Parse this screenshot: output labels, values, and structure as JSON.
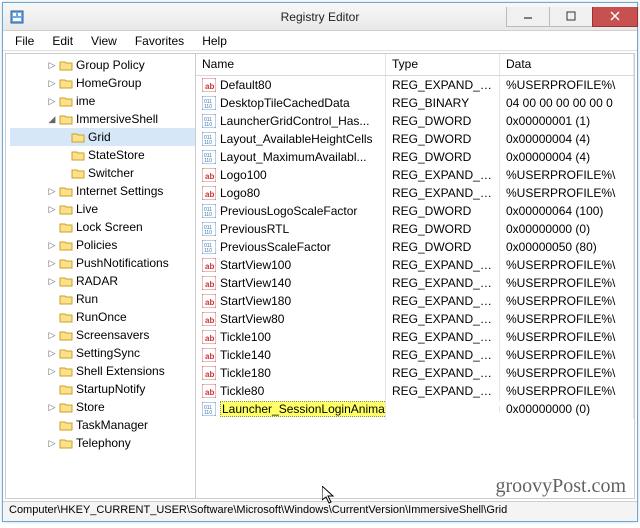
{
  "window": {
    "title": "Registry Editor"
  },
  "menu": {
    "items": [
      "File",
      "Edit",
      "View",
      "Favorites",
      "Help"
    ]
  },
  "tree": {
    "items": [
      {
        "label": "Group Policy",
        "depth": 3,
        "exp": "▷"
      },
      {
        "label": "HomeGroup",
        "depth": 3,
        "exp": "▷"
      },
      {
        "label": "ime",
        "depth": 3,
        "exp": "▷"
      },
      {
        "label": "ImmersiveShell",
        "depth": 3,
        "exp": "◢"
      },
      {
        "label": "Grid",
        "depth": 4,
        "exp": " ",
        "selected": true
      },
      {
        "label": "StateStore",
        "depth": 4,
        "exp": " "
      },
      {
        "label": "Switcher",
        "depth": 4,
        "exp": " "
      },
      {
        "label": "Internet Settings",
        "depth": 3,
        "exp": "▷"
      },
      {
        "label": "Live",
        "depth": 3,
        "exp": "▷"
      },
      {
        "label": "Lock Screen",
        "depth": 3,
        "exp": " "
      },
      {
        "label": "Policies",
        "depth": 3,
        "exp": "▷"
      },
      {
        "label": "PushNotifications",
        "depth": 3,
        "exp": "▷"
      },
      {
        "label": "RADAR",
        "depth": 3,
        "exp": "▷"
      },
      {
        "label": "Run",
        "depth": 3,
        "exp": " "
      },
      {
        "label": "RunOnce",
        "depth": 3,
        "exp": " "
      },
      {
        "label": "Screensavers",
        "depth": 3,
        "exp": "▷"
      },
      {
        "label": "SettingSync",
        "depth": 3,
        "exp": "▷"
      },
      {
        "label": "Shell Extensions",
        "depth": 3,
        "exp": "▷"
      },
      {
        "label": "StartupNotify",
        "depth": 3,
        "exp": " "
      },
      {
        "label": "Store",
        "depth": 3,
        "exp": "▷"
      },
      {
        "label": "TaskManager",
        "depth": 3,
        "exp": " "
      },
      {
        "label": "Telephony",
        "depth": 3,
        "exp": "▷"
      }
    ]
  },
  "list": {
    "headers": {
      "name": "Name",
      "type": "Type",
      "data": "Data"
    },
    "rows": [
      {
        "icon": "str",
        "name": "Default80",
        "type": "REG_EXPAND_SZ",
        "data": "%USERPROFILE%\\"
      },
      {
        "icon": "bin",
        "name": "DesktopTileCachedData",
        "type": "REG_BINARY",
        "data": "04 00 00 00 00 00 0"
      },
      {
        "icon": "bin",
        "name": "LauncherGridControl_Has...",
        "type": "REG_DWORD",
        "data": "0x00000001 (1)"
      },
      {
        "icon": "bin",
        "name": "Layout_AvailableHeightCells",
        "type": "REG_DWORD",
        "data": "0x00000004 (4)"
      },
      {
        "icon": "bin",
        "name": "Layout_MaximumAvailabl...",
        "type": "REG_DWORD",
        "data": "0x00000004 (4)"
      },
      {
        "icon": "str",
        "name": "Logo100",
        "type": "REG_EXPAND_SZ",
        "data": "%USERPROFILE%\\"
      },
      {
        "icon": "str",
        "name": "Logo80",
        "type": "REG_EXPAND_SZ",
        "data": "%USERPROFILE%\\"
      },
      {
        "icon": "bin",
        "name": "PreviousLogoScaleFactor",
        "type": "REG_DWORD",
        "data": "0x00000064 (100)"
      },
      {
        "icon": "bin",
        "name": "PreviousRTL",
        "type": "REG_DWORD",
        "data": "0x00000000 (0)"
      },
      {
        "icon": "bin",
        "name": "PreviousScaleFactor",
        "type": "REG_DWORD",
        "data": "0x00000050 (80)"
      },
      {
        "icon": "str",
        "name": "StartView100",
        "type": "REG_EXPAND_SZ",
        "data": "%USERPROFILE%\\"
      },
      {
        "icon": "str",
        "name": "StartView140",
        "type": "REG_EXPAND_SZ",
        "data": "%USERPROFILE%\\"
      },
      {
        "icon": "str",
        "name": "StartView180",
        "type": "REG_EXPAND_SZ",
        "data": "%USERPROFILE%\\"
      },
      {
        "icon": "str",
        "name": "StartView80",
        "type": "REG_EXPAND_SZ",
        "data": "%USERPROFILE%\\"
      },
      {
        "icon": "str",
        "name": "Tickle100",
        "type": "REG_EXPAND_SZ",
        "data": "%USERPROFILE%\\"
      },
      {
        "icon": "str",
        "name": "Tickle140",
        "type": "REG_EXPAND_SZ",
        "data": "%USERPROFILE%\\"
      },
      {
        "icon": "str",
        "name": "Tickle180",
        "type": "REG_EXPAND_SZ",
        "data": "%USERPROFILE%\\"
      },
      {
        "icon": "str",
        "name": "Tickle80",
        "type": "REG_EXPAND_SZ",
        "data": "%USERPROFILE%\\"
      },
      {
        "icon": "bin",
        "name": "Launcher_SessionLoginAnimation_OnShow",
        "type": "",
        "data": "0x00000000 (0)",
        "highlight": true
      }
    ]
  },
  "statusbar": {
    "path": "Computer\\HKEY_CURRENT_USER\\Software\\Microsoft\\Windows\\CurrentVersion\\ImmersiveShell\\Grid"
  },
  "watermark": "groovyPost.com"
}
